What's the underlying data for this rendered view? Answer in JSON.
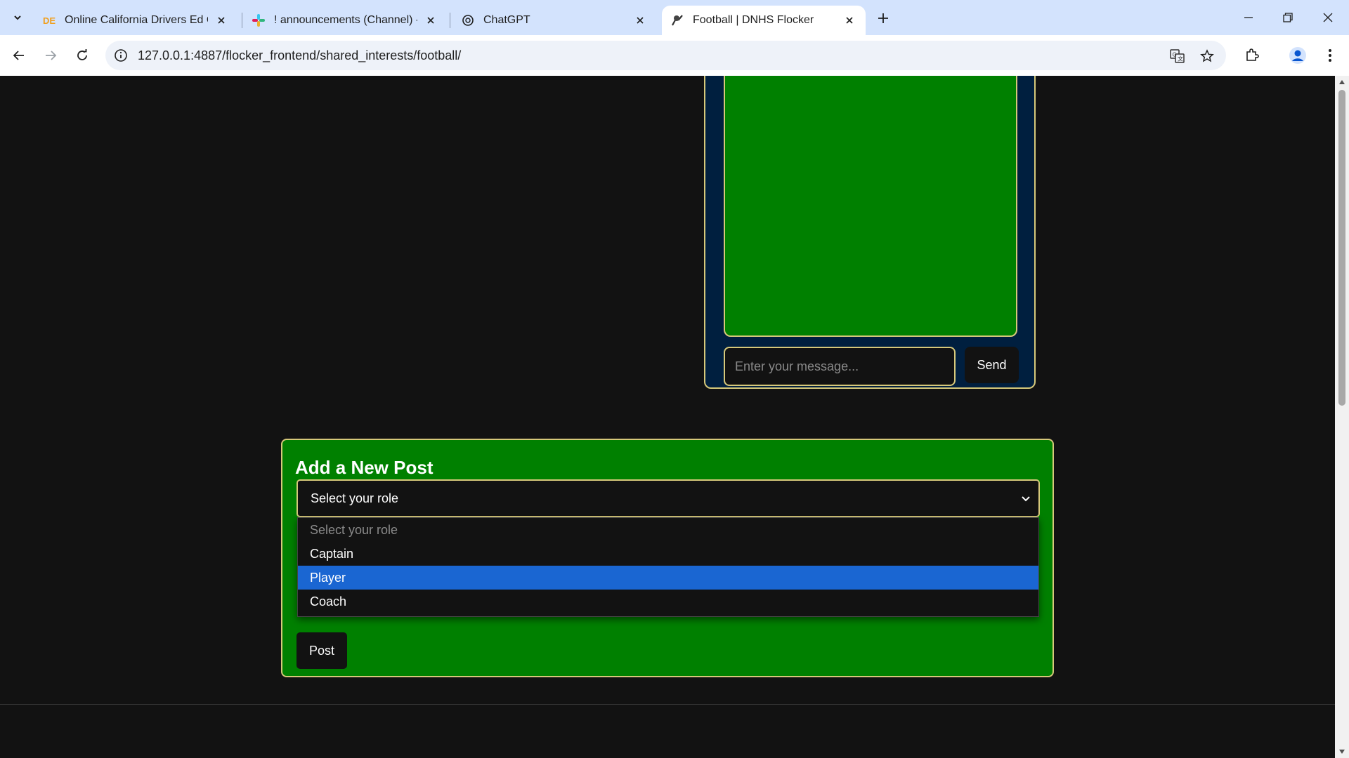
{
  "browser": {
    "tabs": [
      {
        "title": "Online California Drivers Ed Cou",
        "icon": "drivers-ed-favicon",
        "active": false
      },
      {
        "title": "! announcements (Channel) - C",
        "icon": "slack-favicon",
        "active": false
      },
      {
        "title": "ChatGPT",
        "icon": "chatgpt-favicon",
        "active": false
      },
      {
        "title": "Football | DNHS Flocker",
        "icon": "flocker-favicon",
        "active": true
      }
    ],
    "url": "127.0.0.1:4887/flocker_frontend/shared_interests/football/"
  },
  "chat": {
    "input_placeholder": "Enter your message...",
    "send_label": "Send"
  },
  "post_form": {
    "title": "Add a New Post",
    "role_select": {
      "selected": "Select your role",
      "options": [
        {
          "label": "Select your role",
          "placeholder": true
        },
        {
          "label": "Captain"
        },
        {
          "label": "Player",
          "highlighted": true
        },
        {
          "label": "Coach"
        }
      ]
    },
    "post_label": "Post"
  },
  "colors": {
    "page_bg": "#121212",
    "panel_green": "#008000",
    "chat_navy": "#001f3f",
    "gold_border": "#d6c87a",
    "highlight_blue": "#1a66d2"
  }
}
